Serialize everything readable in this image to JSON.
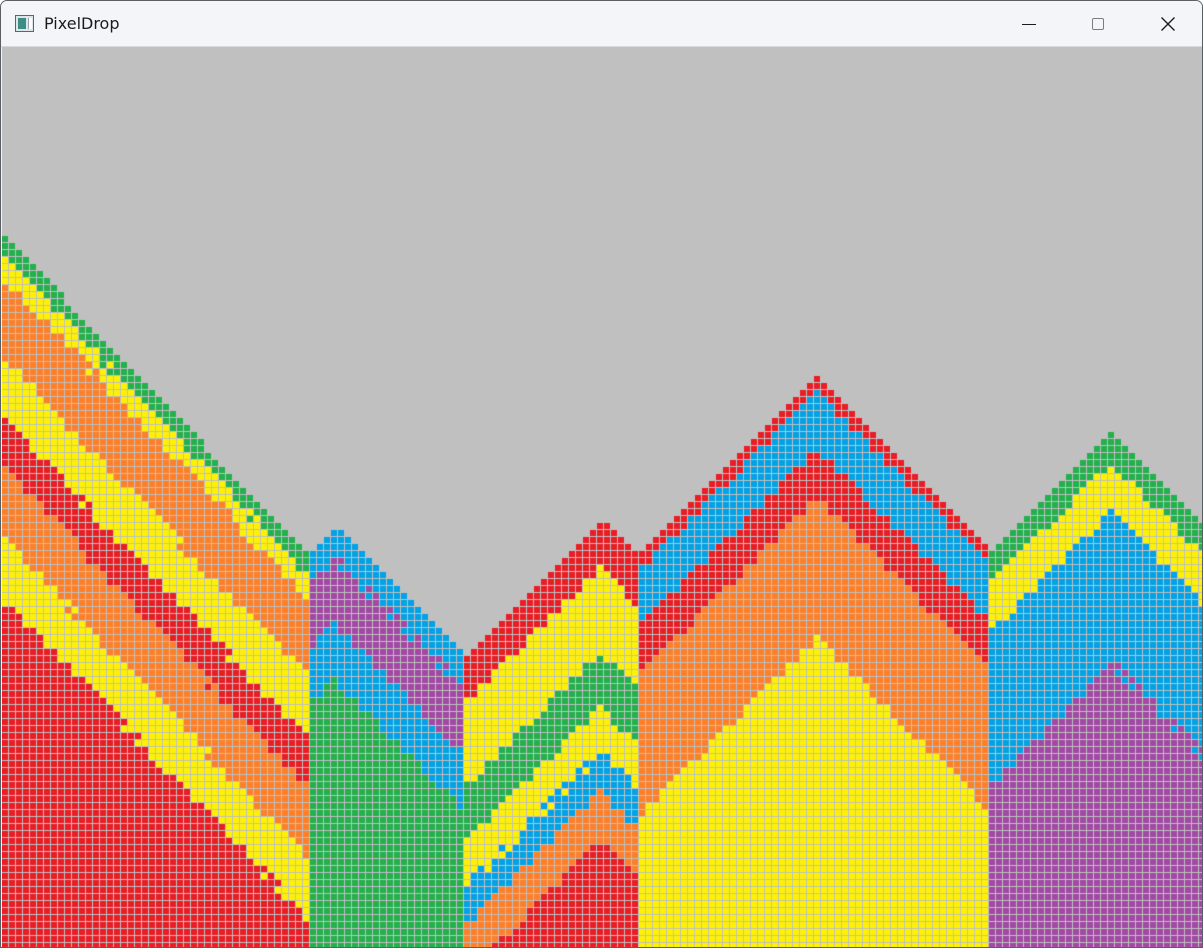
{
  "window": {
    "title": "PixelDrop",
    "icon": "pixeldrop-app-icon",
    "controls": [
      "minimize-icon",
      "maximize-icon",
      "close-icon"
    ]
  },
  "board": {
    "background": "#c0c0c0",
    "palette": {
      "red": "#ec1c24",
      "orange": "#ff7f27",
      "yellow": "#fff200",
      "green": "#22b14c",
      "blue": "#00a2e8",
      "purple": "#a349a4"
    }
  }
}
